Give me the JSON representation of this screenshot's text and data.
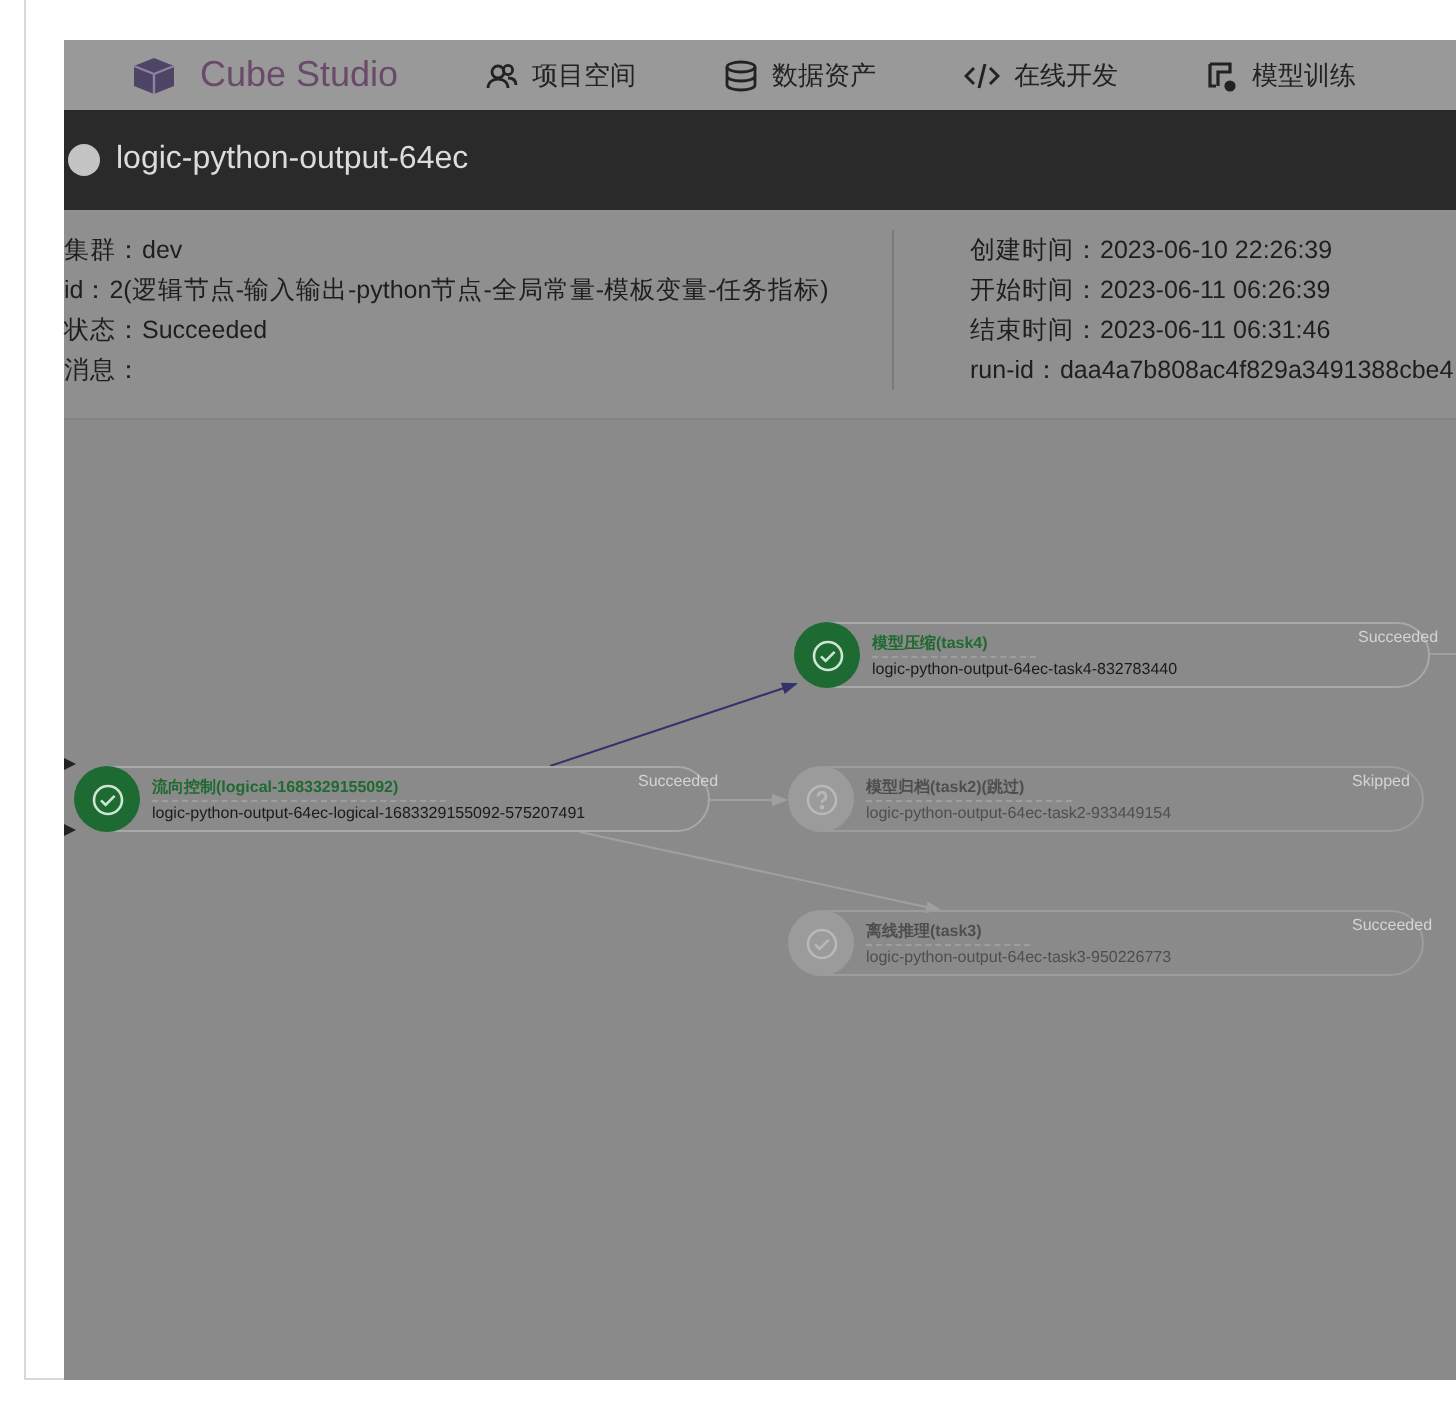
{
  "header": {
    "logo": "Cube Studio",
    "nav": [
      {
        "label": "项目空间",
        "kind": "people"
      },
      {
        "label": "数据资产",
        "kind": "database"
      },
      {
        "label": "在线开发",
        "kind": "code"
      },
      {
        "label": "模型训练",
        "kind": "train"
      }
    ]
  },
  "run": {
    "title": "logic-python-output-64ec",
    "details_left": [
      "集群：dev",
      "id：2(逻辑节点-输入输出-python节点-全局常量-模板变量-任务指标)",
      "状态：Succeeded",
      "消息："
    ],
    "details_right": [
      "创建时间：2023-06-10 22:26:39",
      "开始时间：2023-06-11 06:26:39",
      "结束时间：2023-06-11 06:31:46",
      "run-id：daa4a7b808ac4f829a3491388cbe4"
    ]
  },
  "nodes": [
    {
      "title": "流向控制(logical-1683329155092)",
      "name": "logic-python-output-64ec-logical-1683329155092-575207491",
      "status": "Succeeded",
      "kind": "success",
      "highlighted": true
    },
    {
      "title": "模型压缩(task4)",
      "name": "logic-python-output-64ec-task4-832783440",
      "status": "Succeeded",
      "kind": "success",
      "highlighted": true
    },
    {
      "title": "模型归档(task2)(跳过)",
      "name": "logic-python-output-64ec-task2-933449154",
      "status": "Skipped",
      "kind": "skipped",
      "highlighted": false
    },
    {
      "title": "离线推理(task3)",
      "name": "logic-python-output-64ec-task3-950226773",
      "status": "Succeeded",
      "kind": "success",
      "highlighted": false
    }
  ]
}
